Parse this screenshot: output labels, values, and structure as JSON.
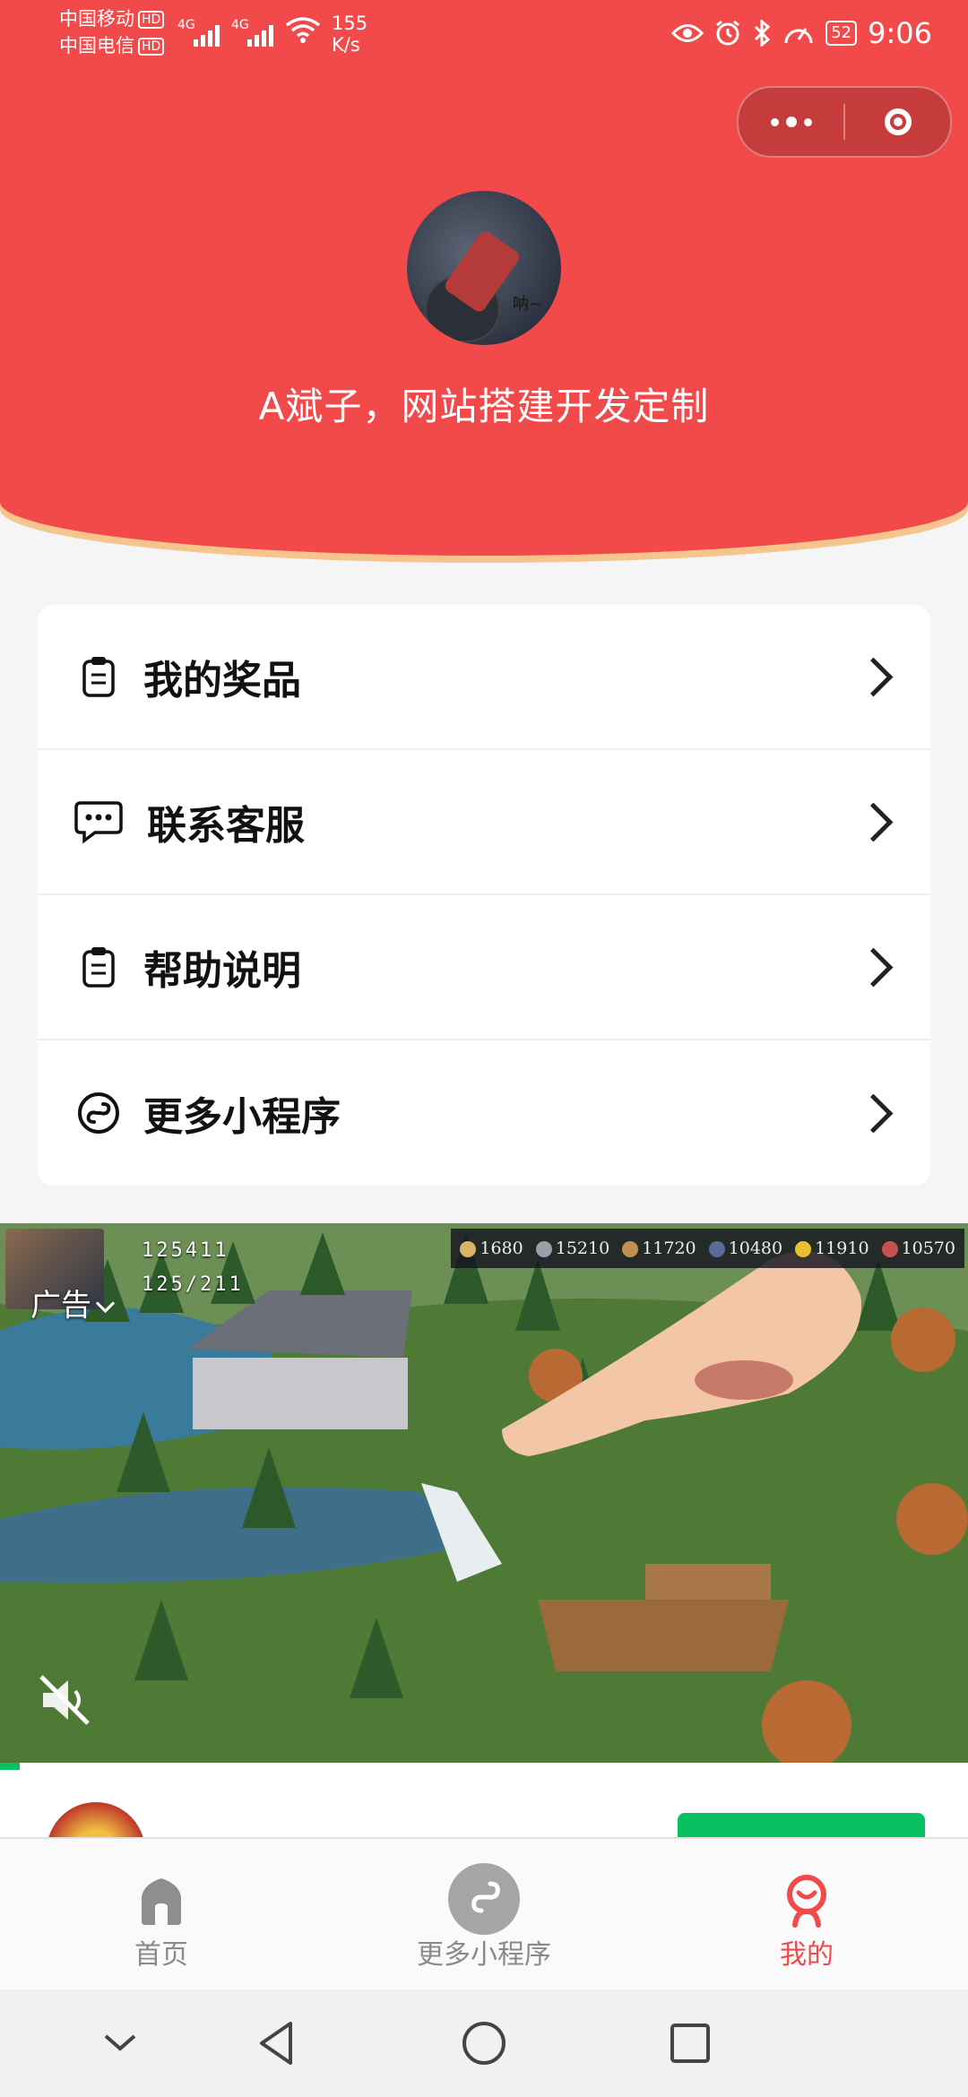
{
  "status_bar": {
    "carrier_1": "中国移动",
    "carrier_2": "中国电信",
    "hd": "HD",
    "network_1": "4G",
    "network_2": "4G",
    "speed_value": "155",
    "speed_unit": "K/s",
    "battery": "52",
    "time": "9:06"
  },
  "capsule": {
    "more_icon": "more-dots-icon",
    "close_icon": "target-circle-icon"
  },
  "profile": {
    "avatar_caption": "呐~",
    "name": "A斌子，网站搭建开发定制"
  },
  "menu": {
    "items": [
      {
        "label": "我的奖品",
        "icon": "clipboard-icon"
      },
      {
        "label": "联系客服",
        "icon": "chat-bubble-icon"
      },
      {
        "label": "帮助说明",
        "icon": "clipboard-icon"
      },
      {
        "label": "更多小程序",
        "icon": "miniprogram-icon"
      }
    ]
  },
  "ad": {
    "tag": "广告",
    "hero_stats": [
      "125411",
      "125/211"
    ],
    "resources": [
      "1680",
      "15210",
      "11720",
      "10480",
      "11910",
      "10570"
    ],
    "progress_fraction": 0.02
  },
  "tabbar": {
    "tabs": [
      {
        "label": "首页",
        "icon": "home-icon"
      },
      {
        "label": "更多小程序",
        "icon": "miniprogram-icon"
      },
      {
        "label": "我的",
        "icon": "profile-icon"
      }
    ],
    "active_index": 2,
    "active_color": "#f24a4b",
    "inactive_color": "#8a8a8a"
  },
  "theme": {
    "primary": "#f24a4b",
    "accent": "#07c160"
  }
}
